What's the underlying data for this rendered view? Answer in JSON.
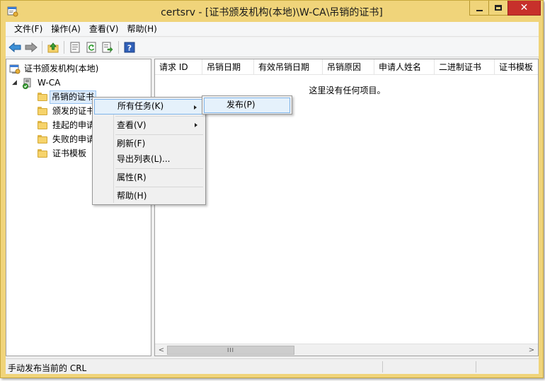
{
  "window": {
    "title": "certsrv - [证书颁发机构(本地)\\W-CA\\吊销的证书]",
    "close_glyph": "✕"
  },
  "menubar": {
    "items": [
      "文件(F)",
      "操作(A)",
      "查看(V)",
      "帮助(H)"
    ]
  },
  "toolbar": {
    "icons": [
      "back-icon",
      "forward-icon",
      "up-folder-icon",
      "properties-icon",
      "refresh-icon",
      "export-icon",
      "help-icon"
    ]
  },
  "tree": {
    "root": "证书颁发机构(本地)",
    "ca": "W-CA",
    "items": [
      "吊销的证书",
      "颁发的证书",
      "挂起的申请",
      "失败的申请",
      "证书模板"
    ]
  },
  "list": {
    "columns": [
      "请求 ID",
      "吊销日期",
      "有效吊销日期",
      "吊销原因",
      "申请人姓名",
      "二进制证书",
      "证书模板"
    ],
    "empty_message": "这里没有任何项目。",
    "scroll_thumb": "III"
  },
  "context_menu": {
    "all_tasks": "所有任务(K)",
    "view": "查看(V)",
    "refresh": "刷新(F)",
    "export": "导出列表(L)...",
    "properties": "属性(R)",
    "help": "帮助(H)"
  },
  "submenu": {
    "publish": "发布(P)"
  },
  "statusbar": {
    "text": "手动发布当前的 CRL"
  },
  "colors": {
    "title_bar": "#f0d47a",
    "close_button": "#c7302b",
    "selection": "#e5f1fb"
  }
}
